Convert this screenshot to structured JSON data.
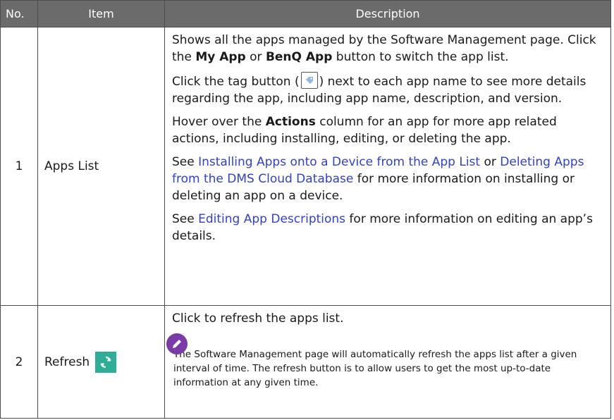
{
  "header": {
    "no": "No.",
    "item": "Item",
    "description": "Description"
  },
  "rows": [
    {
      "no": "1",
      "item": "Apps List",
      "p1": {
        "a": "Shows all the apps managed by the Software Management page. Click the ",
        "b1": "My App",
        "c": " or ",
        "b2": "BenQ App",
        "d": " button to switch the app list."
      },
      "p2": {
        "a": "Click the tag button (",
        "icon": "tag-icon",
        "b": ") next to each app name to see more details regarding the app, including app name, description, and version."
      },
      "p3": {
        "a": "Hover over the ",
        "b": "Actions",
        "c": " column for an app for more app related actions, including installing, editing, or deleting the app."
      },
      "p4": {
        "a": "See ",
        "link1": "Installing Apps onto a Device from the App List",
        "b": " or ",
        "link2": "Deleting Apps from the DMS Cloud Database",
        "c": " for more information on installing or deleting an app on a device."
      },
      "p5": {
        "a": "See ",
        "link": "Editing App Descriptions",
        "b": " for more information on editing an app’s details."
      }
    },
    {
      "no": "2",
      "item": "Refresh",
      "icon": "refresh-icon",
      "p1": "Click to refresh the apps list.",
      "note_icon": "pencil-note-icon",
      "note": "The Software Management page will automatically refresh the apps list after a given interval of time. The refresh button is to allow users to get the most up-to-date information at any given time."
    }
  ],
  "colors": {
    "header_bg": "#6b6b6b",
    "link": "#2f3fd6",
    "refresh_bg": "#2fae97",
    "note_icon_bg": "#7a3aa8"
  }
}
